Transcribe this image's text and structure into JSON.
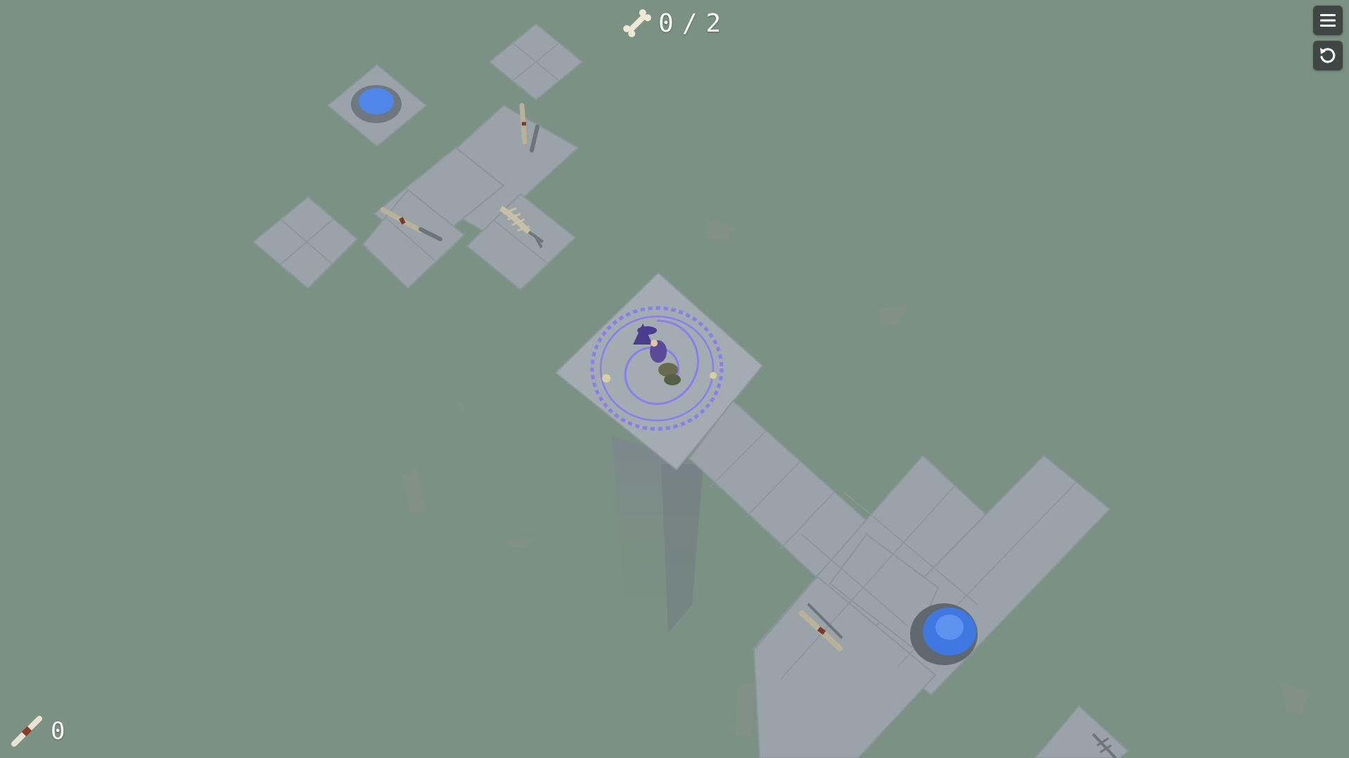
{
  "hud": {
    "bones_collected": "0",
    "bones_separator": "/",
    "bones_total": "2",
    "scrolls_count": "0"
  },
  "controls": {
    "menu_icon": "hamburger-menu-icon",
    "restart_icon": "restart-icon"
  },
  "colors": {
    "background": "#7b9183",
    "tile": "#9aa3a7",
    "tile_edge": "#8a9398",
    "portal": "#8b7cf0",
    "button_blue": "#4f86e8",
    "hud_button": "#3f4644"
  },
  "scene": {
    "player": "witch-character",
    "items": [
      "scroll",
      "scroll",
      "scroll",
      "skeleton"
    ],
    "switches": [
      "blue-pressure-plate",
      "blue-pressure-plate"
    ]
  }
}
